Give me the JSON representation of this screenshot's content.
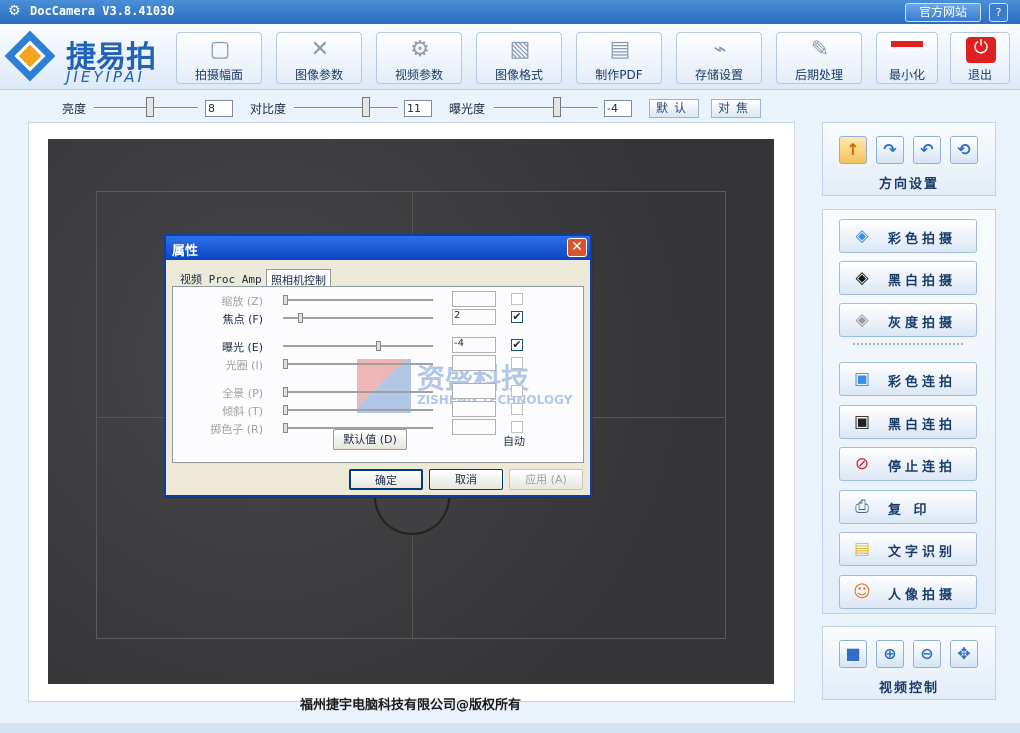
{
  "window": {
    "title": "DocCamera V3.8.41030",
    "website_label": "官方网站",
    "help_label": "?"
  },
  "logo": {
    "cn": "捷易拍",
    "en": "JIEYIPAI"
  },
  "toolbar": {
    "items": [
      {
        "label": "拍摄幅面",
        "icon": "camera-frame-icon"
      },
      {
        "label": "图像参数",
        "icon": "tools-icon"
      },
      {
        "label": "视频参数",
        "icon": "gears-icon"
      },
      {
        "label": "图像格式",
        "icon": "image-format-icon"
      },
      {
        "label": "制作PDF",
        "icon": "pdf-icon"
      },
      {
        "label": "存储设置",
        "icon": "usb-storage-icon"
      },
      {
        "label": "后期处理",
        "icon": "post-process-icon"
      },
      {
        "label": "最小化",
        "icon": "minimize-icon"
      },
      {
        "label": "退出",
        "icon": "power-icon"
      }
    ]
  },
  "adjust": {
    "brightness": {
      "label": "亮度",
      "value": "8",
      "position": 0.55
    },
    "contrast": {
      "label": "对比度",
      "value": "11",
      "position": 0.72
    },
    "exposure": {
      "label": "曝光度",
      "value": "-4",
      "position": 0.6
    },
    "default_label": "默认",
    "focus_label": "对焦"
  },
  "copyright": "福州捷宇电脑科技有限公司@版权所有",
  "dialog": {
    "title": "属性",
    "tabs": [
      "视频 Proc Amp",
      "照相机控制"
    ],
    "rows": [
      {
        "label": "缩放 (Z)",
        "value": "",
        "checked": false,
        "enabled": false,
        "position": 0.0
      },
      {
        "label": "焦点 (F)",
        "value": "2",
        "checked": true,
        "enabled": true,
        "position": 0.1
      },
      {
        "label": "曝光 (E)",
        "value": "-4",
        "checked": true,
        "enabled": true,
        "position": 0.62
      },
      {
        "label": "光圈 (I)",
        "value": "",
        "checked": false,
        "enabled": false,
        "position": 0.0
      },
      {
        "label": "全景 (P)",
        "value": "",
        "checked": false,
        "enabled": false,
        "position": 0.0
      },
      {
        "label": "倾斜 (T)",
        "value": "",
        "checked": false,
        "enabled": false,
        "position": 0.0
      },
      {
        "label": "掷色子 (R)",
        "value": "",
        "checked": false,
        "enabled": false,
        "position": 0.0
      }
    ],
    "default_btn": "默认值 (D)",
    "auto_label": "自动",
    "ok": "确定",
    "cancel": "取消",
    "apply": "应用 (A)",
    "watermark": {
      "cn": "资盛科技",
      "en": "ZISHENG TECHNOLOGY"
    }
  },
  "orientation": {
    "caption": "方向设置",
    "buttons": [
      {
        "icon": "arrow-up-icon",
        "glyph": "↑",
        "selected": true
      },
      {
        "icon": "rotate-cw-icon",
        "glyph": "↷",
        "selected": false
      },
      {
        "icon": "rotate-ccw-icon",
        "glyph": "↶",
        "selected": false
      },
      {
        "icon": "flip-icon",
        "glyph": "⟲",
        "selected": false
      }
    ]
  },
  "capture": {
    "buttons": [
      {
        "label": "彩色拍摄",
        "icon": "color-capture-icon",
        "glyph": "◈",
        "color": "#3a8de0"
      },
      {
        "label": "黑白拍摄",
        "icon": "bw-capture-icon",
        "glyph": "◈",
        "color": "#111111"
      },
      {
        "label": "灰度拍摄",
        "icon": "gray-capture-icon",
        "glyph": "◈",
        "color": "#9a9a9a"
      }
    ]
  },
  "continuous": {
    "buttons": [
      {
        "label": "彩色连拍",
        "icon": "color-burst-icon",
        "glyph": "▣",
        "color": "#3a8de0"
      },
      {
        "label": "黑白连拍",
        "icon": "bw-burst-icon",
        "glyph": "▣",
        "color": "#222222"
      },
      {
        "label": "停止连拍",
        "icon": "stop-icon",
        "glyph": "⊘",
        "color": "#d62020"
      },
      {
        "label": "复  印",
        "icon": "printer-icon",
        "glyph": "⎙",
        "color": "#4a6a8a"
      },
      {
        "label": "文字识别",
        "icon": "ocr-note-icon",
        "glyph": "▤",
        "color": "#e8b820"
      },
      {
        "label": "人像拍摄",
        "icon": "portrait-icon",
        "glyph": "☺",
        "color": "#e07a20"
      }
    ]
  },
  "video_ctrl": {
    "caption": "视频控制",
    "buttons": [
      {
        "icon": "video-camera-icon",
        "glyph": "■"
      },
      {
        "icon": "zoom-in-icon",
        "glyph": "⊕"
      },
      {
        "icon": "zoom-out-icon",
        "glyph": "⊖"
      },
      {
        "icon": "fit-screen-icon",
        "glyph": "✥"
      }
    ]
  }
}
